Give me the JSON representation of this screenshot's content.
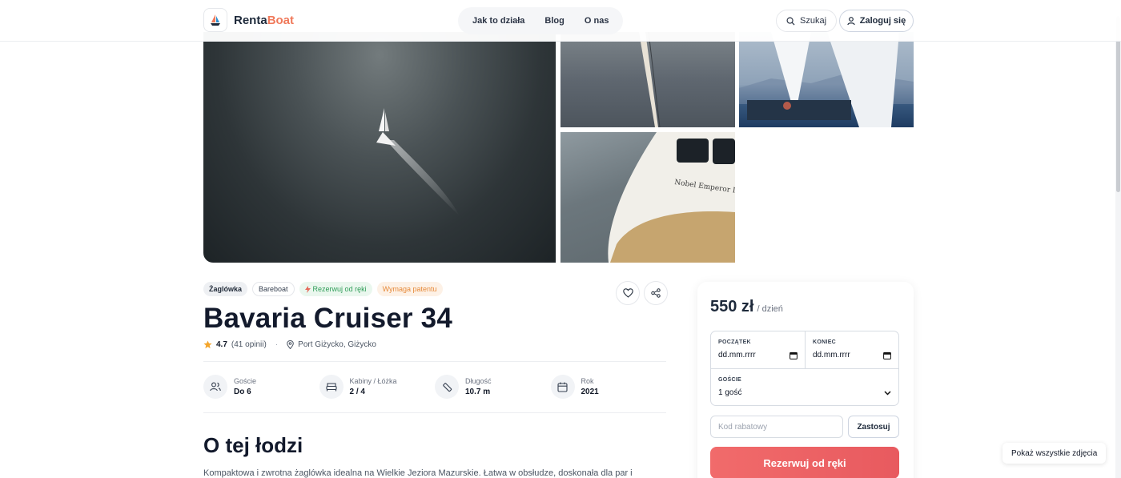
{
  "header": {
    "logo_text_part1": "Renta",
    "logo_text_part2": "Boat",
    "nav": [
      "Jak to działa",
      "Blog",
      "O nas"
    ],
    "search_label": "Szukaj",
    "login_label": "Zaloguj się"
  },
  "gallery": {
    "boat_name_on_hull": "Nobel Emperor II",
    "show_all_label": "Pokaż wszystkie zdjęcia"
  },
  "listing": {
    "tags": [
      "Żaglówka",
      "Bareboat",
      "Rezerwuj od ręki",
      "Wymaga patentu"
    ],
    "title": "Bavaria Cruiser 34",
    "rating": "4.7",
    "reviews": "(41 opinii)",
    "location": "Port Giżycko, Giżycko",
    "specs": [
      {
        "label": "Goście",
        "value": "Do 6"
      },
      {
        "label": "Kabiny / Łóżka",
        "value": "2 / 4"
      },
      {
        "label": "Długość",
        "value": "10.7 m"
      },
      {
        "label": "Rok",
        "value": "2021"
      }
    ],
    "about_heading": "O tej łodzi",
    "description": "Kompaktowa i zwrotna żaglówka idealna na Wielkie Jeziora Mazurskie. Łatwa w obsłudze, doskonała dla par i"
  },
  "booking": {
    "price": "550 zł",
    "price_unit": "/ dzień",
    "start_label": "POCZĄTEK",
    "end_label": "KONIEC",
    "start_value": "dd.mm.rrrr",
    "end_value": "dd.mm.rrrr",
    "guests_label": "GOŚCIE",
    "guests_value": "1 gość",
    "coupon_placeholder": "Kod rabatowy",
    "apply_label": "Zastosuj",
    "book_label": "Rezerwuj od ręki"
  },
  "colors": {
    "brand_dark": "#1e2a3b",
    "brand_accent": "#f0795a",
    "cta": "#e85a5f",
    "tag_green": "#2f9d58",
    "tag_orange": "#e68a3a"
  }
}
